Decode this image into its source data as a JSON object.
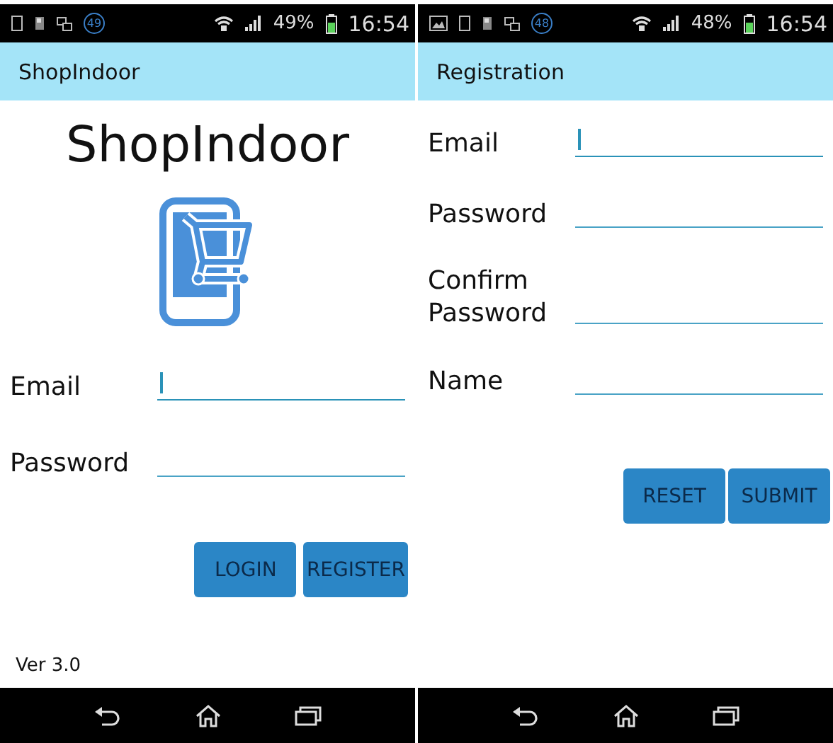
{
  "screens": [
    {
      "kind": "login",
      "status_bar": {
        "picture_notification": false,
        "notification_count": "49",
        "battery": "49%",
        "time": "16:54"
      },
      "app_bar": {
        "title": "ShopIndoor"
      },
      "heading": "ShopIndoor",
      "fields": [
        {
          "label": "Email",
          "focused": true
        },
        {
          "label": "Password",
          "focused": false
        }
      ],
      "buttons": [
        "LOGIN",
        "REGISTER"
      ],
      "version": "Ver 3.0"
    },
    {
      "kind": "registration",
      "status_bar": {
        "picture_notification": true,
        "notification_count": "48",
        "battery": "48%",
        "time": "16:54"
      },
      "app_bar": {
        "title": "Registration"
      },
      "fields": [
        {
          "label": "Email",
          "focused": true
        },
        {
          "label": "Password",
          "focused": false
        },
        {
          "label": "Confirm Password",
          "focused": false
        },
        {
          "label": "Name",
          "focused": false
        }
      ],
      "buttons": [
        "RESET",
        "SUBMIT"
      ]
    }
  ]
}
